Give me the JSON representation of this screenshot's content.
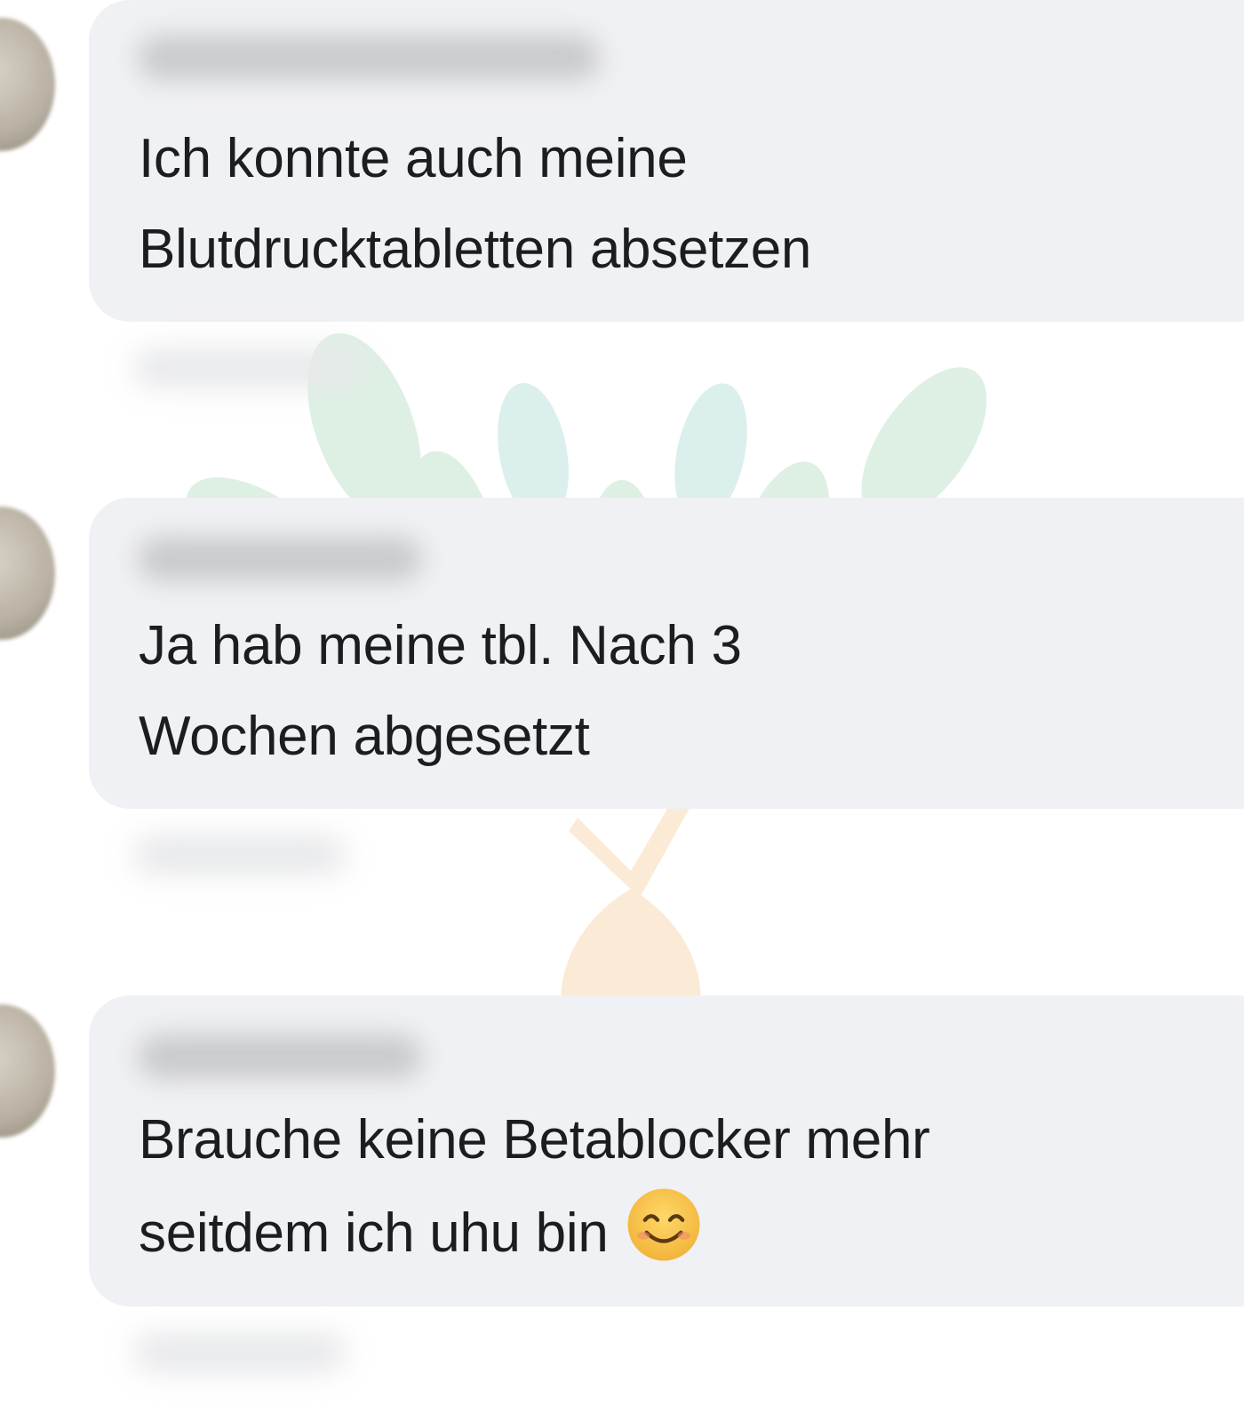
{
  "comments": [
    {
      "lines": [
        "Ich konnte auch meine",
        "Blutdrucktabletten absetzen"
      ]
    },
    {
      "lines": [
        "Ja hab meine tbl.  Nach 3",
        "Wochen abgesetzt"
      ]
    },
    {
      "lines": [
        "Brauche keine Betablocker mehr",
        "seitdem ich uhu bin"
      ],
      "trailing_icon": "smiling-face-emoji-icon"
    }
  ],
  "colors": {
    "bubble": "#f0f1f4",
    "text": "#1c1d1f",
    "watermark_leaf_green": "#6fbf8a",
    "watermark_leaf_teal": "#5fb8b0",
    "watermark_orange": "#f0a64a"
  }
}
